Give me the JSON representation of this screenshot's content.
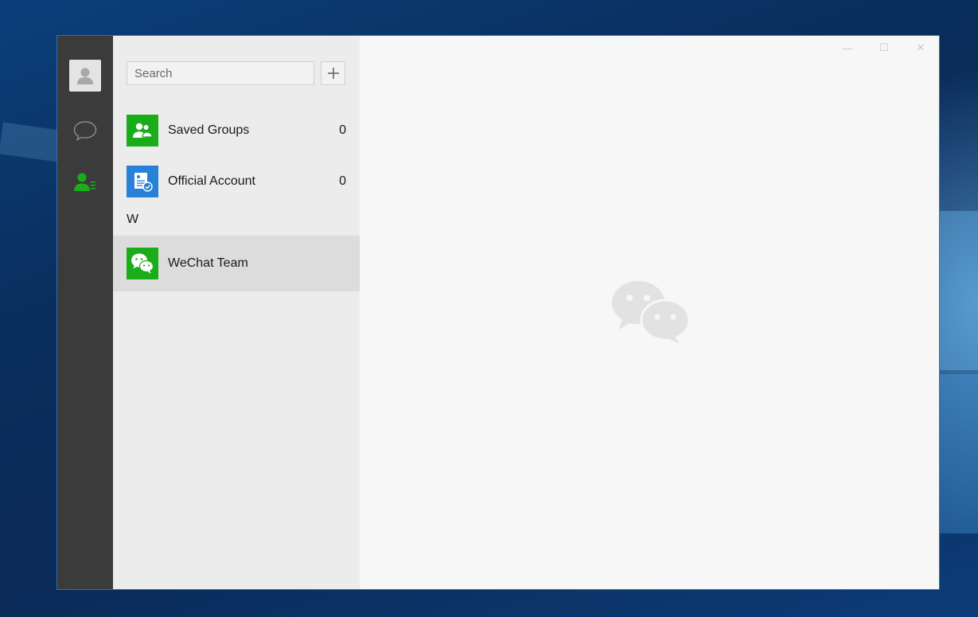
{
  "window": {
    "controls": {
      "minimize_icon": "minimize-icon",
      "maximize_icon": "maximize-icon",
      "close_icon": "close-icon",
      "minimize_glyph": "—",
      "maximize_glyph": "☐",
      "close_glyph": "✕"
    }
  },
  "navbar": {
    "items": [
      {
        "name": "chats",
        "icon": "chat-bubble-icon",
        "active": false
      },
      {
        "name": "contacts",
        "icon": "contacts-icon",
        "active": true
      }
    ]
  },
  "search": {
    "placeholder": "Search",
    "value": "",
    "add_glyph": "+"
  },
  "contacts": {
    "special": [
      {
        "label": "Saved Groups",
        "count": "0",
        "icon": "group-icon",
        "color": "#1aad19"
      },
      {
        "label": "Official Account",
        "count": "0",
        "icon": "official-account-icon",
        "color": "#2782d7"
      }
    ],
    "sections": [
      {
        "letter": "W",
        "items": [
          {
            "label": "WeChat Team",
            "icon": "wechat-logo-icon",
            "color": "#1aad19",
            "selected": true
          }
        ]
      }
    ]
  },
  "colors": {
    "accent": "#1aad19",
    "official": "#2782d7",
    "navbar": "#3b3b3b",
    "list_bg": "#ececec",
    "main_bg": "#f7f7f7"
  }
}
